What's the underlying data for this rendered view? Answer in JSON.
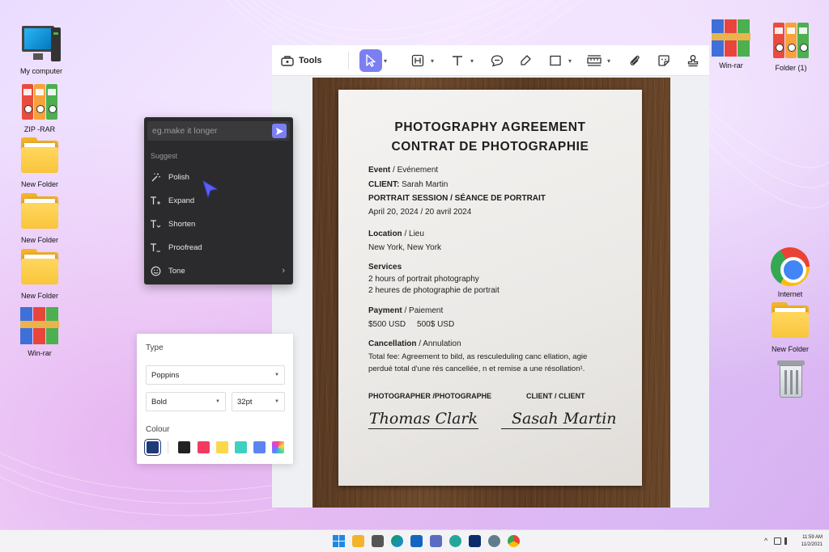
{
  "desktop": {
    "left_icons": [
      {
        "label": "My computer",
        "icon": "computer-icon"
      },
      {
        "label": "ZIP -RAR",
        "icon": "zip-archive-icon"
      },
      {
        "label": "New Folder",
        "icon": "folder-icon"
      },
      {
        "label": "New Folder",
        "icon": "folder-icon"
      },
      {
        "label": "New Folder",
        "icon": "folder-icon"
      },
      {
        "label": "Win-rar",
        "icon": "winrar-icon"
      }
    ],
    "right_icons": [
      {
        "label": "Win-rar",
        "icon": "winrar-icon"
      },
      {
        "label": "Folder (1)",
        "icon": "zip-archive-icon"
      },
      {
        "label": "Internet",
        "icon": "chrome-icon"
      },
      {
        "label": "New Folder",
        "icon": "folder-icon"
      },
      {
        "label": "",
        "icon": "recycle-bin-icon"
      }
    ]
  },
  "toolbar": {
    "tools_label": "Tools",
    "tools": [
      "select-tool",
      "heading-tool",
      "text-tool",
      "comment-tool",
      "highlight-tool",
      "shape-tool",
      "measure-tool",
      "attach-tool",
      "sticker-tool",
      "stamp-tool"
    ],
    "accent": "#7b7ff2"
  },
  "document": {
    "title_en": "PHOTOGRAPHY AGREEMENT",
    "title_fr": "CONTRAT DE PHOTOGRAPHIE",
    "event_label": "Event",
    "event_label_fr": " / Evénement",
    "client_label": "CLIENT:",
    "client_name": "Sarah Martin",
    "session": "PORTRAIT SESSION / SÉANCE DE PORTRAIT",
    "date": "April 20, 2024 / 20 avril 2024",
    "location_label": "Location",
    "location_label_fr": " / Lieu",
    "location": "New York, New York",
    "services_label": "Services",
    "services_en": "2 hours of portrait photography",
    "services_fr": "2 heures de photographie de portrait",
    "payment_label": "Payment",
    "payment_label_fr": " / Paiement",
    "payment_usd": "$500 USD",
    "payment_fr": "500$ USD",
    "cancel_label": "Cancellation",
    "cancel_label_fr": " / Annulation",
    "cancel_line1": "Total fee: Agreement to bild, as resculeduling canc ellation, agie",
    "cancel_line2": "perdué total d'une rés cancellée, n et remise a une résollation¹.",
    "photographer_head": "PHOTOGRAPHER /PHOTOGRAPHE",
    "client_head": "CLIENT / CLIENT",
    "photographer_sig": "Thomas Clark",
    "client_sig": "Sasah Martin"
  },
  "ai_panel": {
    "placeholder": "eg.make it longer",
    "suggest_label": "Suggest",
    "items": [
      "Polish",
      "Expand",
      "Shorten",
      "Proofread",
      "Tone"
    ]
  },
  "type_panel": {
    "type_label": "Type",
    "font": "Poppins",
    "weight": "Bold",
    "size": "32pt",
    "colour_label": "Colour",
    "swatches": [
      "#1f3b7a",
      "#222222",
      "#f23a63",
      "#f9d84a",
      "#3fd1c0",
      "#5a86f2",
      "gradient"
    ]
  },
  "taskbar": {
    "time": "11:59 AM",
    "date": "11/2/2021",
    "tray_chevron": "^"
  }
}
